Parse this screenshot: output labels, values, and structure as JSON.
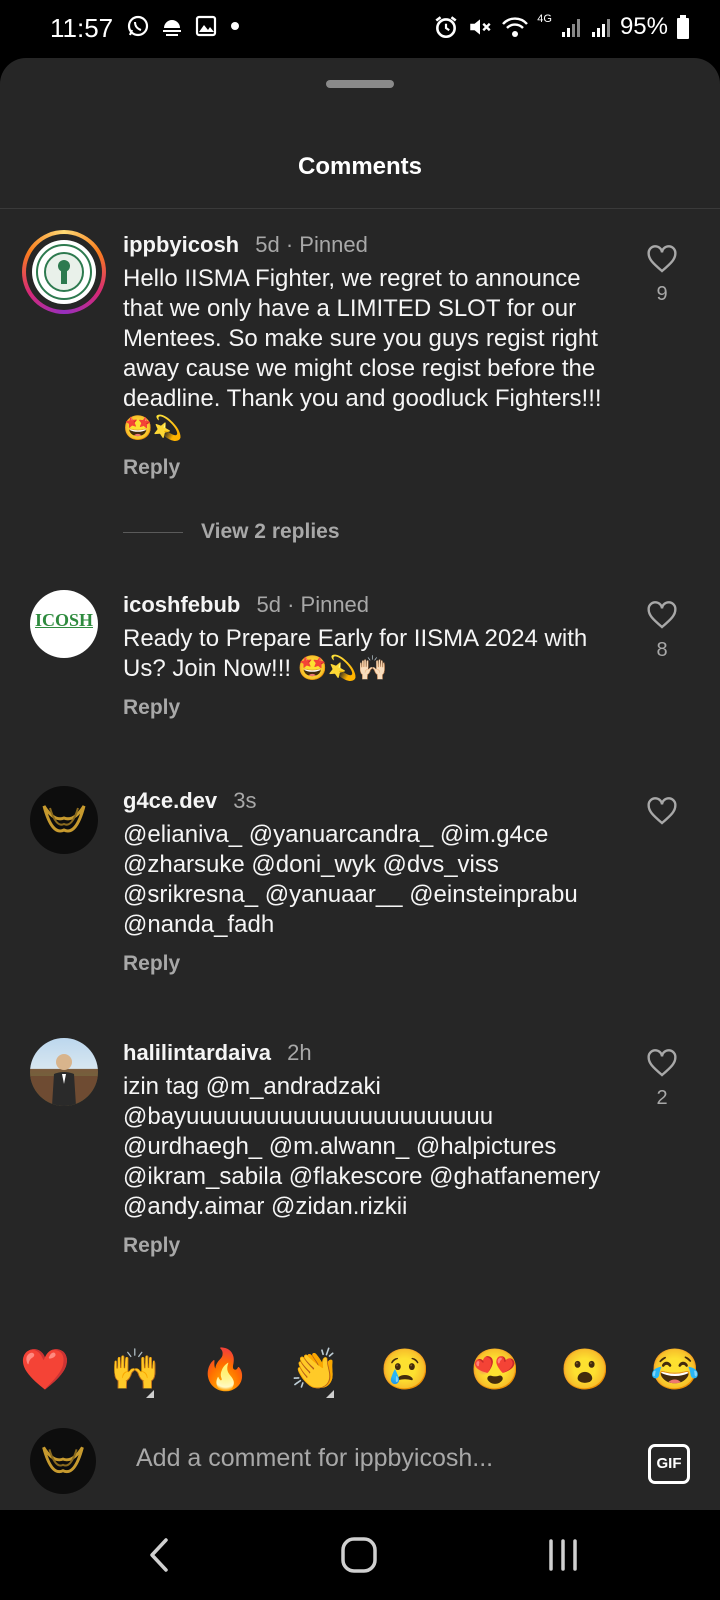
{
  "status_bar": {
    "time": "11:57",
    "battery": "95%",
    "network": "4G"
  },
  "sheet": {
    "title": "Comments"
  },
  "comments": [
    {
      "username": "ippbyicosh",
      "time": "5d",
      "pinned": "· Pinned",
      "text": "Hello IISMA Fighter, we regret to announce that we only have a LIMITED SLOT for our Mentees. So make sure you guys regist right away cause we might close regist before the deadline. Thank you and goodluck Fighters!!! 🤩💫",
      "likes": "9",
      "reply": "Reply",
      "view_replies": "View 2 replies"
    },
    {
      "username": "icoshfebub",
      "time": "5d",
      "pinned": "· Pinned",
      "avatar_text": "ICOSH",
      "text": "Ready to Prepare Early for IISMA 2024 with Us? Join Now!!! 🤩💫🙌🏻",
      "likes": "8",
      "reply": "Reply"
    },
    {
      "username": "g4ce.dev",
      "time": "3s",
      "text": "@elianiva_ @yanuarcandra_ @im.g4ce @zharsuke @doni_wyk @dvs_viss @srikresna_ @yanuaar__ @einsteinprabu @nanda_fadh",
      "likes": "",
      "reply": "Reply"
    },
    {
      "username": "halilintardaiva",
      "time": "2h",
      "text": "izin tag @m_andradzaki @bayuuuuuuuuuuuuuuuuuuuuuuu @urdhaegh_ @m.alwann_ @halpictures @ikram_sabila @flakescore @ghatfanemery @andy.aimar @zidan.rizkii",
      "likes": "2",
      "reply": "Reply"
    }
  ],
  "emoji_bar": [
    "❤️",
    "🙌",
    "🔥",
    "👏",
    "😢",
    "😍",
    "😮",
    "😂"
  ],
  "composer": {
    "placeholder": "Add a comment for ippbyicosh...",
    "gif_label": "GIF"
  },
  "colors": {
    "sheet_bg": "#262626",
    "primary_text": "#f5f5f5",
    "secondary_text": "#a8a8a8"
  }
}
